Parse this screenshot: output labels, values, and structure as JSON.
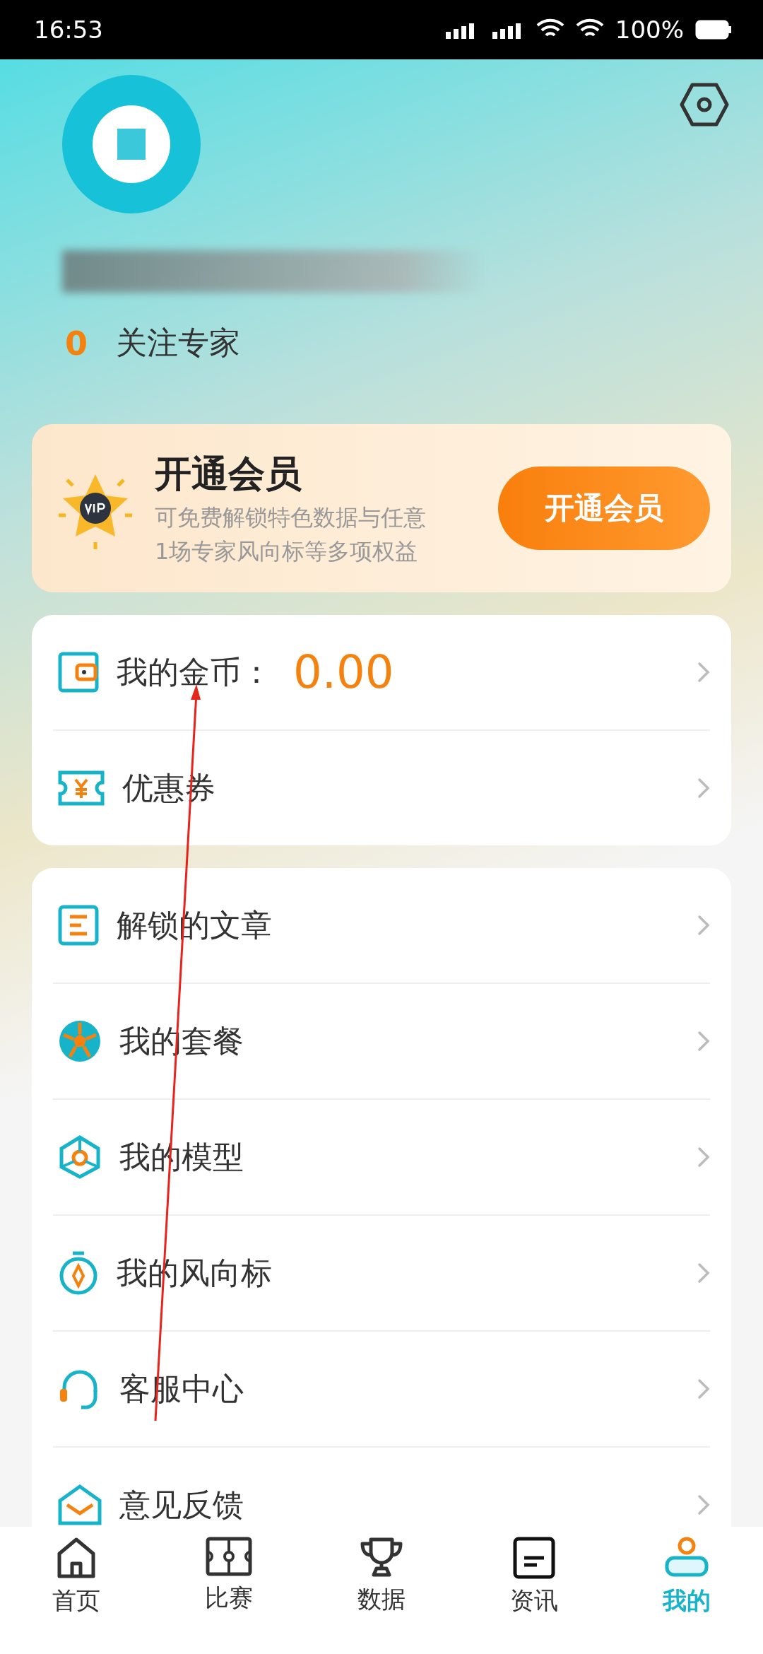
{
  "status_bar": {
    "time": "16:53",
    "battery": "100%"
  },
  "profile": {
    "following_count": "0",
    "following_label": "关注专家"
  },
  "vip": {
    "title": "开通会员",
    "description_lines": [
      "可免费解锁特色数据与任意",
      "1场专家风向标等多项权益"
    ],
    "button": "开通会员"
  },
  "wallet_menu": [
    {
      "kind": "balance",
      "label": "我的金币：",
      "value": "0.00"
    },
    {
      "kind": "plain",
      "label": "优惠券"
    }
  ],
  "menu": [
    {
      "label": "解锁的文章"
    },
    {
      "label": "我的套餐"
    },
    {
      "label": "我的模型"
    },
    {
      "label": "我的风向标"
    },
    {
      "label": "客服中心"
    },
    {
      "label": "意见反馈"
    }
  ],
  "tab_bar": [
    {
      "label": "首页",
      "selected": false
    },
    {
      "label": "比赛",
      "selected": false
    },
    {
      "label": "数据",
      "selected": false
    },
    {
      "label": "资讯",
      "selected": false
    },
    {
      "label": "我的",
      "selected": true
    }
  ]
}
